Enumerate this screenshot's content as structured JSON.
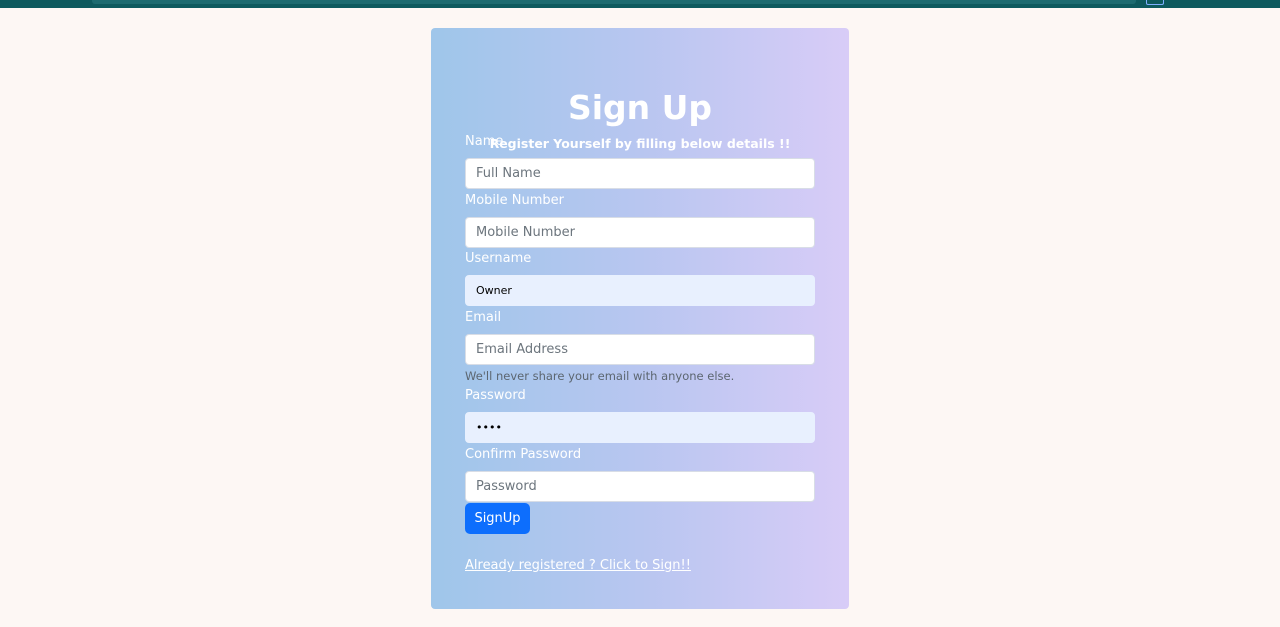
{
  "page": {
    "background": "#fdf7f4",
    "topbar_color": "#0e5a5e"
  },
  "form": {
    "title": "Sign Up",
    "subtitle": "Register Yourself by filling below details !!",
    "gradient": [
      "#9fc6ea",
      "#d8ccf7"
    ],
    "fields": {
      "name": {
        "label": "Name",
        "placeholder": "Full Name",
        "value": ""
      },
      "mobile": {
        "label": "Mobile Number",
        "placeholder": "Mobile Number",
        "value": ""
      },
      "username": {
        "label": "Username",
        "placeholder": "",
        "value": "Owner"
      },
      "email": {
        "label": "Email",
        "placeholder": "Email Address",
        "value": "",
        "hint": "We'll never share your email with anyone else."
      },
      "password": {
        "label": "Password",
        "placeholder": "",
        "value": "••••"
      },
      "confirm_password": {
        "label": "Confirm Password",
        "placeholder": "Password",
        "value": ""
      }
    },
    "submit_label": "SignUp",
    "submit_color": "#0d6efd",
    "signin_link": "Already registered ? Click to Sign!!"
  }
}
